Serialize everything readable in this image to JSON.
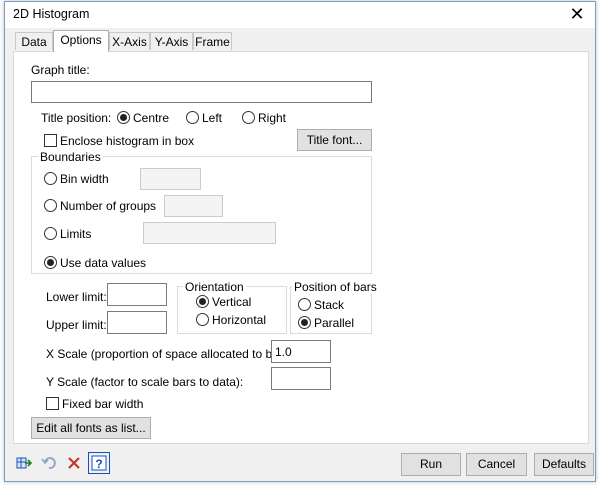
{
  "window": {
    "title": "2D Histogram"
  },
  "tabs": [
    {
      "label": "Data"
    },
    {
      "label": "Options"
    },
    {
      "label": "X-Axis"
    },
    {
      "label": "Y-Axis"
    },
    {
      "label": "Frame"
    }
  ],
  "options": {
    "graph_title_label": "Graph title:",
    "graph_title_value": "",
    "title_position_label": "Title position:",
    "title_positions": [
      "Centre",
      "Left",
      "Right"
    ],
    "title_position_selected": "Centre",
    "enclose_label": "Enclose histogram in box",
    "title_font_button": "Title font...",
    "boundaries": {
      "label": "Boundaries",
      "bin_width": "Bin width",
      "number_of_groups": "Number of groups",
      "limits": "Limits",
      "use_data_values": "Use data values",
      "selected": "Use data values"
    },
    "lower_limit_label": "Lower limit:",
    "upper_limit_label": "Upper limit:",
    "orientation": {
      "label": "Orientation",
      "vertical": "Vertical",
      "horizontal": "Horizontal",
      "selected": "Vertical"
    },
    "position_of_bars": {
      "label": "Position of bars",
      "stack": "Stack",
      "parallel": "Parallel",
      "selected": "Parallel"
    },
    "x_scale_label": "X Scale (proportion of space allocated to bars):",
    "x_scale_value": "1.0",
    "y_scale_label": "Y Scale (factor to scale bars to data):",
    "y_scale_value": "",
    "fixed_bar_width_label": "Fixed bar width",
    "edit_fonts_button": "Edit all fonts as list..."
  },
  "footer": {
    "run": "Run",
    "cancel": "Cancel",
    "defaults": "Defaults"
  },
  "colors": {
    "window_border": "#7a9cc6",
    "button_face": "#e1e1e1",
    "help_icon": "#1a4fbf",
    "clear_icon": "#c0392b"
  }
}
